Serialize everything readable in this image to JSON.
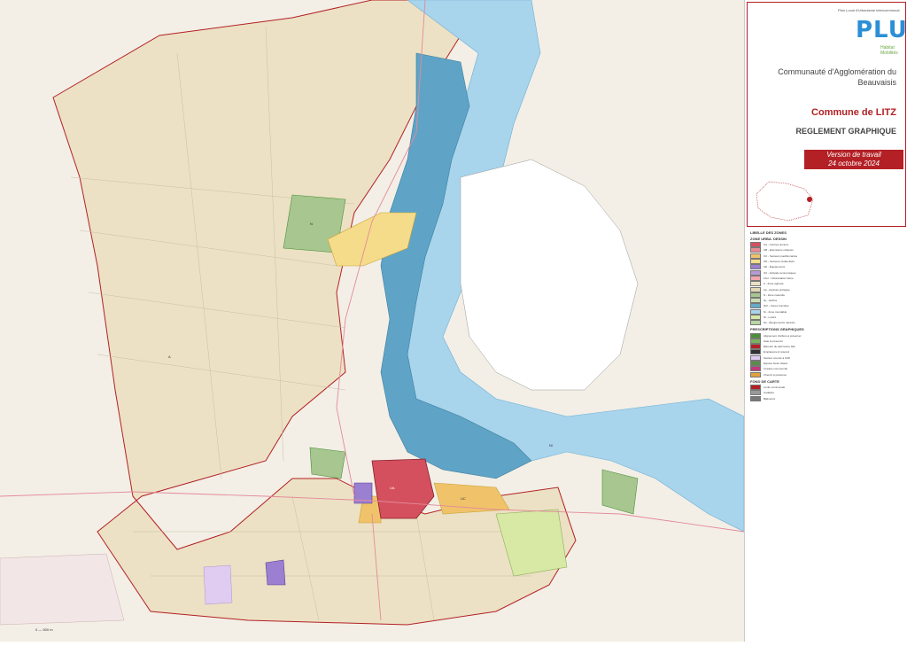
{
  "header": {
    "logo_small": "Plan Local d'Urbanisme intercommunal",
    "logo_word": "PLUi",
    "logo_sub1": "Habitat",
    "logo_sub2": "Mobilités",
    "agglomeration": "Communauté d'Agglomération du Beauvaisis",
    "commune": "Commune de LITZ",
    "document": "REGLEMENT GRAPHIQUE",
    "version_line1": "Version de travail",
    "version_line2": "24 octobre 2024"
  },
  "legend": {
    "title": "LIBELLE DES ZONES",
    "section1": "ZONE URBA. DESSIN",
    "section2": "PRESCRIPTIONS GRAPHIQUES",
    "section3": "FOND DE CARTE",
    "zones": [
      {
        "label": "UA - Centres anciens",
        "color": "#d4505e"
      },
      {
        "label": "UB - Extensions urbaines",
        "color": "#e88b93"
      },
      {
        "label": "UC - Secteurs pavillonnaires",
        "color": "#f0c36a"
      },
      {
        "label": "UD - Secteurs résidentiels",
        "color": "#f5dc8a"
      },
      {
        "label": "UE - Équipements",
        "color": "#9b7fd1"
      },
      {
        "label": "UX - Activités économiques",
        "color": "#b69ad6"
      },
      {
        "label": "1AU - Urbanisation future",
        "color": "#f3a6b0"
      },
      {
        "label": "A - Zone agricole",
        "color": "#eadfc4"
      },
      {
        "label": "Ap - Agricole protégée",
        "color": "#e3d6b3"
      },
      {
        "label": "N - Zone naturelle",
        "color": "#a8c690"
      },
      {
        "label": "Nj - Jardins",
        "color": "#c9dcb0"
      },
      {
        "label": "Nzh - Zones humides",
        "color": "#68a9c8"
      },
      {
        "label": "Ni - Zone inondable",
        "color": "#a8d4ec"
      },
      {
        "label": "Nl - Loisirs",
        "color": "#d7e9a5"
      },
      {
        "label": "Ne - Équipements naturels",
        "color": "#b7d6a1"
      }
    ],
    "prescriptions": [
      {
        "label": "Alignement d'arbres à préserver",
        "color": "#4a8f3a"
      },
      {
        "label": "Haie à préserver",
        "color": "#79b25b"
      },
      {
        "label": "Élément de patrimoine bâti",
        "color": "#b32025"
      },
      {
        "label": "Emplacement réservé",
        "color": "#333333"
      },
      {
        "label": "Secteur soumis à OAP",
        "color": "#e0ccf0"
      },
      {
        "label": "Espace boisé classé",
        "color": "#5b8c4a"
      },
      {
        "label": "Linéaire commercial",
        "color": "#c03a7a"
      },
      {
        "label": "Chemin à préserver",
        "color": "#e0a040"
      }
    ],
    "fond": [
      {
        "label": "Limite communale",
        "color": "#b32025"
      },
      {
        "label": "Cadastre",
        "color": "#999999"
      },
      {
        "label": "Bâtiments",
        "color": "#777777"
      }
    ]
  },
  "map_labels": {
    "zone_a": "A",
    "zone_n": "N",
    "zone_ua": "UA",
    "zone_ub": "UB",
    "zone_uc": "UC",
    "zone_ni": "Ni",
    "scale": "0 — 500 m"
  },
  "colors": {
    "accent": "#b32025",
    "river": "#a8d4ec",
    "wetland": "#4f9bc0",
    "agri": "#eadfc4"
  }
}
